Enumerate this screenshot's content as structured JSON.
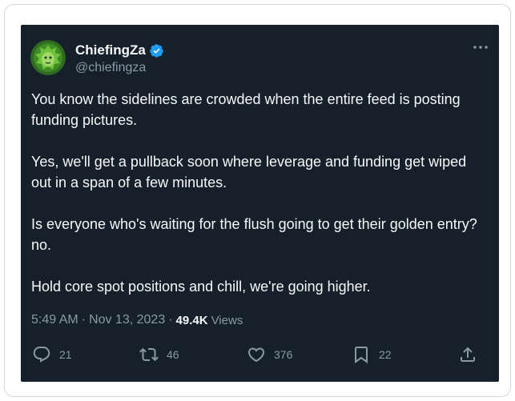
{
  "author": {
    "display_name": "ChiefingZa",
    "handle": "@chiefingza",
    "verified": true
  },
  "tweet": {
    "paragraphs": [
      "You know the sidelines are crowded when the entire feed is posting funding pictures.",
      "Yes, we'll get a pullback soon where leverage and funding get wiped out in a span of a few minutes.",
      "Is everyone who's waiting for the flush going to get their golden entry? no.",
      "Hold core spot positions and chill, we're going higher."
    ],
    "time": "5:49 AM",
    "date": "Nov 13, 2023",
    "views_count": "49.4K",
    "views_label": "Views"
  },
  "actions": {
    "replies": "21",
    "retweets": "46",
    "likes": "376",
    "bookmarks": "22"
  },
  "icons": {
    "more": "more-horizontal-icon",
    "verified": "verified-badge-icon",
    "reply": "reply-icon",
    "retweet": "retweet-icon",
    "like": "heart-icon",
    "bookmark": "bookmark-icon",
    "share": "share-icon"
  },
  "colors": {
    "background": "#15202b",
    "text": "#f7f9f9",
    "secondary_text": "#8b98a5",
    "verified_blue": "#1d9bf0"
  }
}
